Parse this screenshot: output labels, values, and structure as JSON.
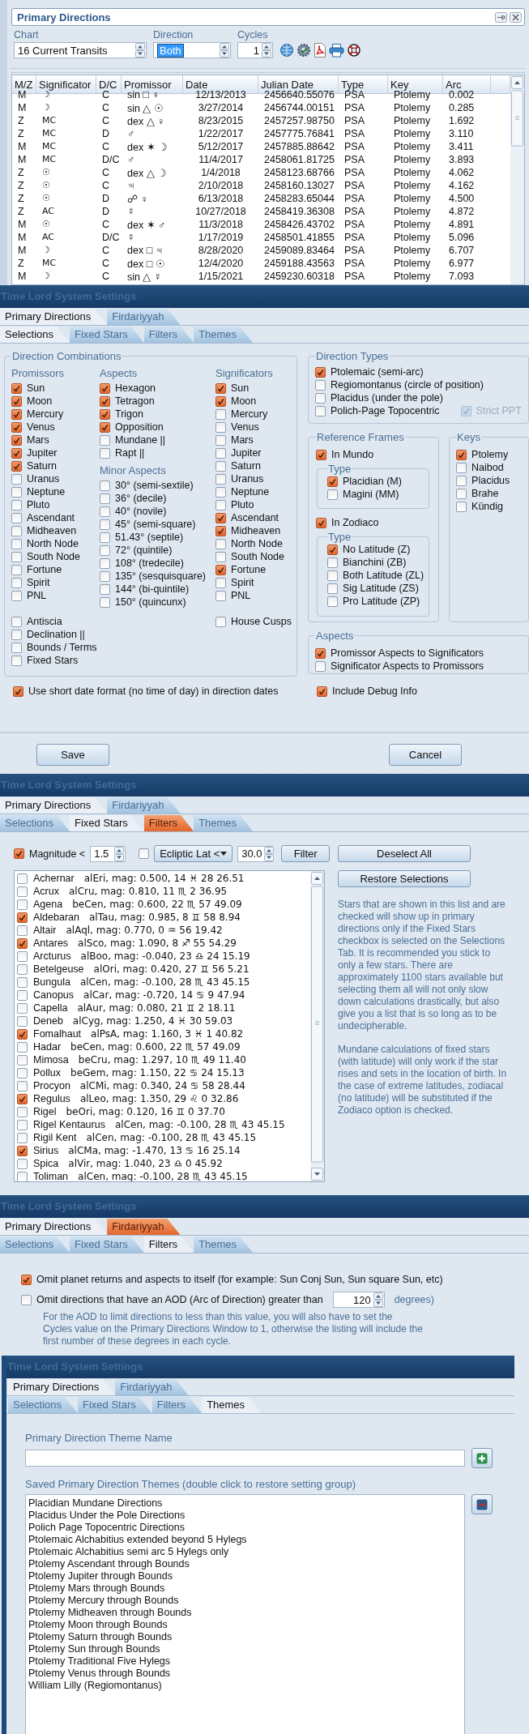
{
  "primary_directions": {
    "title": "Primary Directions",
    "chart": {
      "label": "Chart",
      "value": "16 Current Transits"
    },
    "direction": {
      "label": "Direction",
      "value": "Both"
    },
    "cycles": {
      "label": "Cycles",
      "value": "1"
    },
    "table": {
      "columns": [
        "M/Z",
        "Significator",
        "D/C",
        "Promissor",
        "Date",
        "Julian Date",
        "Type",
        "Key",
        "Arc"
      ],
      "rows": [
        [
          "M",
          "☽",
          "C",
          "sin □ ♀",
          "12/13/2013",
          "2456640.55076",
          "PSA",
          "Ptolemy",
          "0.002"
        ],
        [
          "M",
          "☽",
          "C",
          "sin △ ☉",
          "3/27/2014",
          "2456744.00151",
          "PSA",
          "Ptolemy",
          "0.285"
        ],
        [
          "Z",
          "MC",
          "C",
          "dex △ ♀",
          "8/23/2015",
          "2457257.98750",
          "PSA",
          "Ptolemy",
          "1.692"
        ],
        [
          "Z",
          "MC",
          "D",
          "♂",
          "1/22/2017",
          "2457775.76841",
          "PSA",
          "Ptolemy",
          "3.110"
        ],
        [
          "M",
          "MC",
          "C",
          "dex ✶ ☽",
          "5/12/2017",
          "2457885.88642",
          "PSA",
          "Ptolemy",
          "3.411"
        ],
        [
          "M",
          "MC",
          "D/C",
          "♂",
          "11/4/2017",
          "2458061.81725",
          "PSA",
          "Ptolemy",
          "3.893"
        ],
        [
          "Z",
          "☉",
          "C",
          "dex △ ☽",
          "1/4/2018",
          "2458123.68766",
          "PSA",
          "Ptolemy",
          "4.062"
        ],
        [
          "Z",
          "☉",
          "C",
          "♃",
          "2/10/2018",
          "2458160.13027",
          "PSA",
          "Ptolemy",
          "4.162"
        ],
        [
          "Z",
          "☉",
          "D",
          "☍ ♀",
          "6/13/2018",
          "2458283.65044",
          "PSA",
          "Ptolemy",
          "4.500"
        ],
        [
          "Z",
          "AC",
          "D",
          "☿",
          "10/27/2018",
          "2458419.36308",
          "PSA",
          "Ptolemy",
          "4.872"
        ],
        [
          "M",
          "☉",
          "C",
          "dex ✶ ♂",
          "11/3/2018",
          "2458426.43702",
          "PSA",
          "Ptolemy",
          "4.891"
        ],
        [
          "M",
          "AC",
          "D/C",
          "☿",
          "1/17/2019",
          "2458501.41855",
          "PSA",
          "Ptolemy",
          "5.096"
        ],
        [
          "M",
          "☽",
          "C",
          "dex □ ♃",
          "8/28/2020",
          "2459089.83464",
          "PSA",
          "Ptolemy",
          "6.707"
        ],
        [
          "Z",
          "MC",
          "C",
          "dex □ ☉",
          "12/4/2020",
          "2459188.43563",
          "PSA",
          "Ptolemy",
          "6.977"
        ],
        [
          "M",
          "☽",
          "C",
          "sin △ ☿",
          "1/15/2021",
          "2459230.60318",
          "PSA",
          "Ptolemy",
          "7.093"
        ]
      ]
    }
  },
  "settings_windows": [
    {
      "kind": "selections",
      "title": "Time Lord System Settings",
      "top_tabs": [
        {
          "label": "Primary Directions",
          "selected": true,
          "highlighted": false
        },
        {
          "label": "Firdariyyah",
          "selected": false,
          "highlighted": false
        }
      ],
      "tabs": [
        {
          "label": "Selections",
          "selected": true,
          "highlighted": false
        },
        {
          "label": "Fixed Stars",
          "selected": false,
          "highlighted": false
        },
        {
          "label": "Filters",
          "selected": false,
          "highlighted": false
        },
        {
          "label": "Themes",
          "selected": false,
          "highlighted": false
        }
      ],
      "direction_combinations": {
        "title": "Direction Combinations",
        "promissors": {
          "title": "Promissors",
          "items": [
            {
              "label": "Sun",
              "checked": true
            },
            {
              "label": "Moon",
              "checked": true
            },
            {
              "label": "Mercury",
              "checked": true
            },
            {
              "label": "Venus",
              "checked": true
            },
            {
              "label": "Mars",
              "checked": true
            },
            {
              "label": "Jupiter",
              "checked": true
            },
            {
              "label": "Saturn",
              "checked": true
            },
            {
              "label": "Uranus",
              "checked": false
            },
            {
              "label": "Neptune",
              "checked": false
            },
            {
              "label": "Pluto",
              "checked": false
            },
            {
              "label": "Ascendant",
              "checked": false
            },
            {
              "label": "Midheaven",
              "checked": false
            },
            {
              "label": "North Node",
              "checked": false
            },
            {
              "label": "South Node",
              "checked": false
            },
            {
              "label": "Fortune",
              "checked": false
            },
            {
              "label": "Spirit",
              "checked": false
            },
            {
              "label": "PNL",
              "checked": false
            }
          ]
        },
        "aspects": {
          "title": "Aspects",
          "items": [
            {
              "label": "Hexagon",
              "checked": true
            },
            {
              "label": "Tetragon",
              "checked": true
            },
            {
              "label": "Trigon",
              "checked": true
            },
            {
              "label": "Opposition",
              "checked": true
            },
            {
              "label": "Mundane ||",
              "checked": false
            },
            {
              "label": "Rapt ||",
              "checked": false
            }
          ]
        },
        "minor_aspects": {
          "title": "Minor Aspects",
          "items": [
            {
              "label": "30° (semi-sextile)",
              "checked": false
            },
            {
              "label": "36° (decile)",
              "checked": false
            },
            {
              "label": "40° (novile)",
              "checked": false
            },
            {
              "label": "45° (semi-square)",
              "checked": false
            },
            {
              "label": "51.43° (septile)",
              "checked": false
            },
            {
              "label": "72° (quintile)",
              "checked": false
            },
            {
              "label": "108° (tredecile)",
              "checked": false
            },
            {
              "label": "135° (sesquisquare)",
              "checked": false
            },
            {
              "label": "144° (bi-quintile)",
              "checked": false
            },
            {
              "label": "150° (quincunx)",
              "checked": false
            }
          ]
        },
        "significators": {
          "title": "Significators",
          "items": [
            {
              "label": "Sun",
              "checked": true
            },
            {
              "label": "Moon",
              "checked": true
            },
            {
              "label": "Mercury",
              "checked": false
            },
            {
              "label": "Venus",
              "checked": false
            },
            {
              "label": "Mars",
              "checked": false
            },
            {
              "label": "Jupiter",
              "checked": false
            },
            {
              "label": "Saturn",
              "checked": false
            },
            {
              "label": "Uranus",
              "checked": false
            },
            {
              "label": "Neptune",
              "checked": false
            },
            {
              "label": "Pluto",
              "checked": false
            },
            {
              "label": "Ascendant",
              "checked": true
            },
            {
              "label": "Midheaven",
              "checked": true
            },
            {
              "label": "North Node",
              "checked": false
            },
            {
              "label": "South Node",
              "checked": false
            },
            {
              "label": "Fortune",
              "checked": true
            },
            {
              "label": "Spirit",
              "checked": false
            },
            {
              "label": "PNL",
              "checked": false
            }
          ]
        },
        "extras": [
          {
            "label": "Antiscia",
            "checked": false
          },
          {
            "label": "Declination ||",
            "checked": false
          },
          {
            "label": "Bounds / Terms",
            "checked": false
          },
          {
            "label": "Fixed Stars",
            "checked": false
          }
        ],
        "house_cusps": {
          "label": "House Cusps",
          "checked": false
        }
      },
      "direction_types": {
        "title": "Direction Types",
        "items": [
          {
            "label": "Ptolemaic (semi-arc)",
            "checked": true
          },
          {
            "label": "Regiomontanus (circle of position)",
            "checked": false
          },
          {
            "label": "Placidus (under the pole)",
            "checked": false
          },
          {
            "label": "Polich-Page Topocentric",
            "checked": false
          }
        ],
        "strict_ppt": {
          "label": "Strict PPT",
          "checked": true,
          "disabled": true
        }
      },
      "reference_frames": {
        "title": "Reference Frames",
        "in_mundo": {
          "label": "In Mundo",
          "checked": true
        },
        "mundo_type": {
          "title": "Type",
          "items": [
            {
              "label": "Placidian (M)",
              "checked": true
            },
            {
              "label": "Magini (MM)",
              "checked": false
            }
          ]
        },
        "in_zodiaco": {
          "label": "In Zodiaco",
          "checked": true
        },
        "zodiaco_type": {
          "title": "Type",
          "items": [
            {
              "label": "No Latitude (Z)",
              "checked": true
            },
            {
              "label": "Bianchini (ZB)",
              "checked": false
            },
            {
              "label": "Both Latitude (ZL)",
              "checked": false
            },
            {
              "label": "Sig Latitude (ZS)",
              "checked": false
            },
            {
              "label": "Pro Latitude (ZP)",
              "checked": false
            }
          ]
        }
      },
      "keys": {
        "title": "Keys",
        "items": [
          {
            "label": "Ptolemy",
            "checked": true
          },
          {
            "label": "Naibod",
            "checked": false
          },
          {
            "label": "Placidus",
            "checked": false
          },
          {
            "label": "Brahe",
            "checked": false
          },
          {
            "label": "Kündig",
            "checked": false
          }
        ]
      },
      "aspects": {
        "title": "Aspects",
        "items": [
          {
            "label": "Promissor Aspects to Significators",
            "checked": true
          },
          {
            "label": "Significator Aspects to Promissors",
            "checked": false
          }
        ]
      },
      "short_date": {
        "label": "Use short date format (no time of day) in direction dates",
        "checked": true
      },
      "debug": {
        "label": "Include Debug Info",
        "checked": true
      },
      "buttons": [
        "Save",
        "Cancel"
      ]
    },
    {
      "kind": "fixed_stars",
      "title": "Time Lord System Settings",
      "top_tabs": [
        {
          "label": "Primary Directions",
          "selected": true,
          "highlighted": false
        },
        {
          "label": "Firdariyyah",
          "selected": false,
          "highlighted": false
        }
      ],
      "tabs": [
        {
          "label": "Selections",
          "selected": false,
          "highlighted": false
        },
        {
          "label": "Fixed Stars",
          "selected": true,
          "highlighted": false
        },
        {
          "label": "Filters",
          "selected": false,
          "highlighted": true
        },
        {
          "label": "Themes",
          "selected": false,
          "highlighted": false
        }
      ],
      "magnitude": {
        "label": "Magnitude <",
        "checked": true,
        "value": "1.5"
      },
      "latitude": {
        "checked": false,
        "mode": "Ecliptic Lat <",
        "value": "30.0"
      },
      "filter_button": "Filter",
      "deselect_button": "Deselect All",
      "restore_button": "Restore Selections",
      "stars": [
        {
          "name": "Achernar",
          "details": "alEri, mag: 0.500, 14 ♓ 28 26.51",
          "checked": false
        },
        {
          "name": "Acrux",
          "details": "alCru, mag: 0.810, 11 ♏ 2 36.95",
          "checked": false
        },
        {
          "name": "Agena",
          "details": "beCen, mag: 0.600, 22 ♏ 57 49.09",
          "checked": false
        },
        {
          "name": "Aldebaran",
          "details": "alTau, mag: 0.985, 8 ♊ 58 8.94",
          "checked": true
        },
        {
          "name": "Altair",
          "details": "alAql, mag: 0.770, 0 ♒ 56 19.42",
          "checked": false
        },
        {
          "name": "Antares",
          "details": "alSco, mag: 1.090, 8 ♐ 55 54.29",
          "checked": true
        },
        {
          "name": "Arcturus",
          "details": "alBoo, mag: -0.040, 23 ♎ 24 15.19",
          "checked": false
        },
        {
          "name": "Betelgeuse",
          "details": "alOri, mag: 0.420, 27 ♊ 56 5.21",
          "checked": false
        },
        {
          "name": "Bungula",
          "details": "alCen, mag: -0.100, 28 ♏ 43 45.15",
          "checked": false
        },
        {
          "name": "Canopus",
          "details": "alCar, mag: -0.720, 14 ♋ 9 47.94",
          "checked": false
        },
        {
          "name": "Capella",
          "details": "alAur, mag: 0.080, 21 ♊ 2 18.11",
          "checked": false
        },
        {
          "name": "Deneb",
          "details": "alCyg, mag: 1.250, 4 ♓ 30 59.03",
          "checked": false
        },
        {
          "name": "Fomalhaut",
          "details": "alPsA, mag: 1.160, 3 ♓ 1 40.82",
          "checked": true
        },
        {
          "name": "Hadar",
          "details": "beCen, mag: 0.600, 22 ♏ 57 49.09",
          "checked": false
        },
        {
          "name": "Mimosa",
          "details": "beCru, mag: 1.297, 10 ♏ 49 11.40",
          "checked": false
        },
        {
          "name": "Pollux",
          "details": "beGem, mag: 1.150, 22 ♋ 24 15.13",
          "checked": false
        },
        {
          "name": "Procyon",
          "details": "alCMi, mag: 0.340, 24 ♋ 58 28.44",
          "checked": false
        },
        {
          "name": "Regulus",
          "details": "alLeo, mag: 1.350, 29 ♌ 0 32.86",
          "checked": true
        },
        {
          "name": "Rigel",
          "details": "beOri, mag: 0.120, 16 ♊ 0 37.70",
          "checked": false
        },
        {
          "name": "Rigel Kentaurus",
          "details": "alCen, mag: -0.100, 28 ♏ 43 45.15",
          "checked": false
        },
        {
          "name": "Rigil Kent",
          "details": "alCen, mag: -0.100, 28 ♏ 43 45.15",
          "checked": false
        },
        {
          "name": "Sirius",
          "details": "alCMa, mag: -1.470, 13 ♋ 16 25.14",
          "checked": true
        },
        {
          "name": "Spica",
          "details": "alVir, mag: 1.040, 23 ♎ 0 45.92",
          "checked": false
        },
        {
          "name": "Toliman",
          "details": "alCen, mag: -0.100, 28 ♏ 43 45.15",
          "checked": false
        }
      ],
      "help": [
        "Stars that are shown in this list and are checked will show up in primary directions only if the Fixed Stars checkbox is selected on the Selections Tab.  It is recommended you stick to only a few stars.  There are approximately 1100 stars available but selecting them all will not only slow down calculations drastically, but also give you a list that is so long as to be undecipherable.",
        "Mundane calculations of fixed stars (with latitude) will only work if the star rises and sets in the location of birth.  In the case of extreme latitudes, zodiacal (no latitude) will be substituted if the Zodiaco option is checked."
      ]
    },
    {
      "kind": "filters",
      "title": "Time Lord System Settings",
      "top_tabs": [
        {
          "label": "Primary Directions",
          "selected": true,
          "highlighted": false
        },
        {
          "label": "Firdariyyah",
          "selected": false,
          "highlighted": true
        }
      ],
      "tabs": [
        {
          "label": "Selections",
          "selected": false,
          "highlighted": false
        },
        {
          "label": "Fixed Stars",
          "selected": false,
          "highlighted": false
        },
        {
          "label": "Filters",
          "selected": true,
          "highlighted": false
        },
        {
          "label": "Themes",
          "selected": false,
          "highlighted": false
        }
      ],
      "omit_returns": {
        "label": "Omit planet returns and aspects to itself (for example: Sun Conj Sun, Sun square Sun, etc)",
        "checked": true
      },
      "omit_aod": {
        "label": "Omit directions that have an AOD (Arc of Direction) greater than",
        "checked": false,
        "value": "120",
        "unit": "degrees)"
      },
      "note": "For the AOD to limit directions to less than this value, you will also have to set the Cycles value on the Primary Directions Window to 1, otherwise the listing will include the first number of these degrees in each cycle."
    },
    {
      "kind": "themes",
      "title": "Time Lord System Settings",
      "top_tabs": [
        {
          "label": "Primary Directions",
          "selected": true,
          "highlighted": false
        },
        {
          "label": "Firdariyyah",
          "selected": false,
          "highlighted": false
        }
      ],
      "tabs": [
        {
          "label": "Selections",
          "selected": false,
          "highlighted": false
        },
        {
          "label": "Fixed Stars",
          "selected": false,
          "highlighted": false
        },
        {
          "label": "Filters",
          "selected": false,
          "highlighted": false
        },
        {
          "label": "Themes",
          "selected": true,
          "highlighted": false
        }
      ],
      "name_label": "Primary Direction Theme Name",
      "saved_label": "Saved Primary Direction Themes (double click to restore setting group)",
      "themes": [
        "Placidian Mundane Directions",
        "Placidus Under the Pole Directions",
        "Polich Page Topocentric Directions",
        "Ptolemaic Alchabitius extended beyond 5 Hylegs",
        "Ptolemaic Alchabitius semi arc 5 Hylegs only",
        "Ptolemy Ascendant through Bounds",
        "Ptolemy Jupiter through Bounds",
        "Ptolemy Mars through Bounds",
        "Ptolemy Mercury through Bounds",
        "Ptolemy Midheaven through Bounds",
        "Ptolemy Moon through Bounds",
        "Ptolemy Saturn through Bounds",
        "Ptolemy Sun through Bounds",
        "Ptolemy Traditional Five Hylegs",
        "Ptolemy Venus through Bounds",
        "William Lilly (Regiomontanus)"
      ]
    }
  ]
}
